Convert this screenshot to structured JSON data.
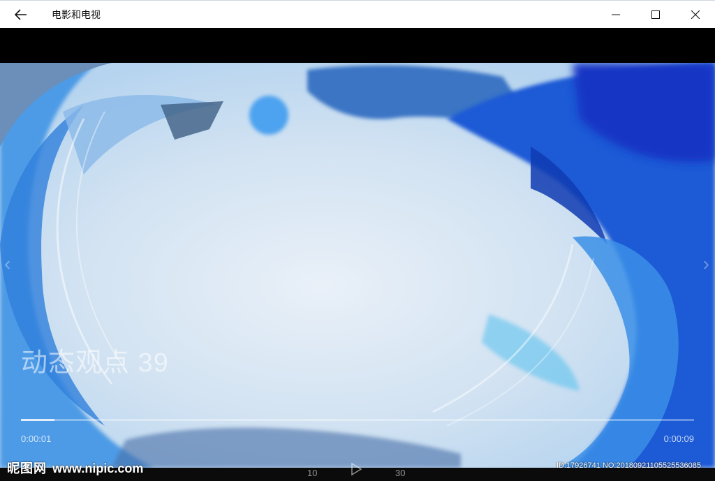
{
  "window": {
    "title": "电影和电视",
    "back_icon": "arrow-left-icon",
    "minimize_icon": "minimize-icon",
    "maximize_icon": "maximize-icon",
    "close_icon": "close-icon"
  },
  "player": {
    "overlay_title": "动态观点 39",
    "current_time": "0:00:01",
    "total_time": "0:00:09",
    "progress": 0.05,
    "skip_back_label": "10",
    "skip_forward_label": "30",
    "prev_icon": "chevron-left-icon",
    "next_icon": "chevron-right-icon",
    "play_icon": "play-icon"
  },
  "watermark": {
    "brand": "昵图网",
    "url": "www.nipic.com",
    "id_text": "ID:17926741 NO:20180921105525536085"
  },
  "colors": {
    "titlebar_bg": "#ffffff",
    "letterbox": "#000000",
    "brush_dark": "#1d4fcf",
    "brush_mid": "#3d8ee6",
    "brush_light": "#8fc3f0",
    "center_light": "#dbe8f5"
  }
}
